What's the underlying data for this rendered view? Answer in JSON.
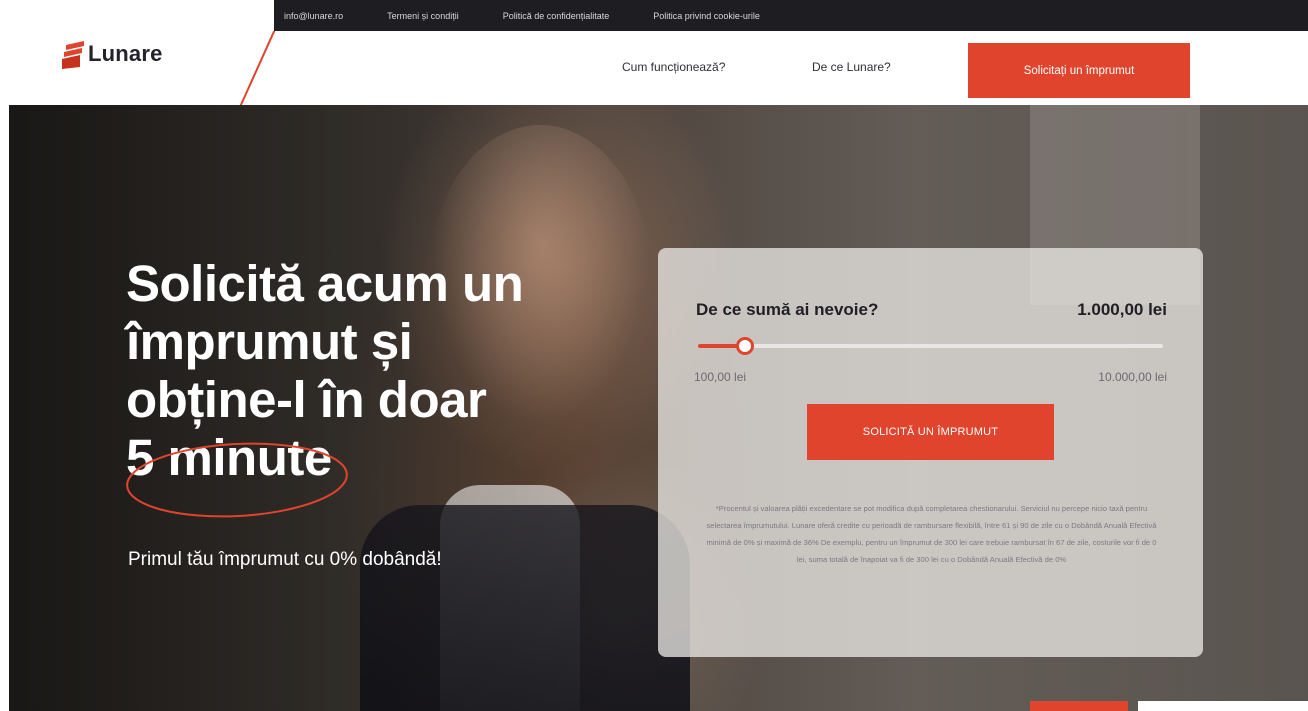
{
  "topbar": {
    "links": [
      "info@lunare.ro",
      "Termeni și condiții",
      "Politică de confidențialitate",
      "Politica privind cookie-urile"
    ]
  },
  "header": {
    "logo_text": "Lunare",
    "nav": [
      "Cum funcționează?",
      "De ce Lunare?"
    ],
    "cta_label": "Solicitați un împrumut"
  },
  "hero": {
    "title_lines": [
      "Solicită acum un",
      "împrumut și",
      "obține-l în doar",
      "5 minute"
    ],
    "subtitle": "Primul tău împrumut cu 0% dobândă!"
  },
  "calculator": {
    "question": "De ce sumă ai nevoie?",
    "amount": "1.000,00 lei",
    "min": "100,00 lei",
    "max": "10.000,00 lei",
    "slider_fraction": 0.1,
    "button_label": "SOLICITĂ UN ÎMPRUMUT",
    "note": "*Procentul și valoarea plății excedentare se pot modifica după completarea chestionarului. Serviciul nu percepe nicio taxă pentru selectarea împrumutului. Lunare oferă credite cu perioadă de rambursare flexibilă, între 61 și 90 de zile cu o Dobândă Anuală Efectivă minimă de 0% și maximă de 36% De exemplu, pentru un împrumut de 300 lei care trebuie rambursat în 67 de zile, costurile vor fi de 0 lei, suma totală de înapoiat va fi de 300 lei cu o Dobândă Anuală Efectivă de 0%"
  },
  "colors": {
    "accent": "#e0442d",
    "topbar": "#1e1d22",
    "text_dark": "#1f1f25"
  }
}
